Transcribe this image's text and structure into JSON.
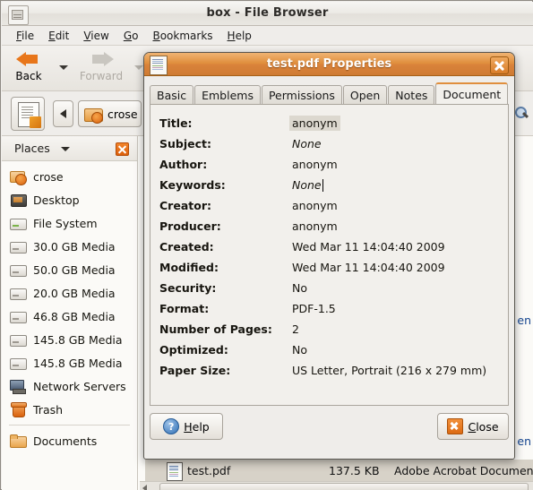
{
  "file_browser": {
    "window_title": "box - File Browser",
    "window_icon": "drive-icon",
    "menus": [
      {
        "label": "File",
        "accel": "F"
      },
      {
        "label": "Edit",
        "accel": "E"
      },
      {
        "label": "View",
        "accel": "V"
      },
      {
        "label": "Go",
        "accel": "G"
      },
      {
        "label": "Bookmarks",
        "accel": "B"
      },
      {
        "label": "Help",
        "accel": "H"
      }
    ],
    "toolbar": {
      "back_label": "Back",
      "forward_label": "Forward",
      "back_icon": "arrow-left-icon",
      "forward_icon": "arrow-right-icon"
    },
    "location_bar": {
      "edit_location_icon": "document-edit-icon",
      "scroll_left_icon": "triangle-left-icon",
      "path_button_label": "crose",
      "path_button_icon": "home-folder-icon"
    },
    "sidebar": {
      "header_label": "Places",
      "header_caret_icon": "chevron-down-icon",
      "close_icon": "close-icon",
      "items": [
        {
          "label": "crose",
          "icon": "home-folder-icon"
        },
        {
          "label": "Desktop",
          "icon": "desktop-icon"
        },
        {
          "label": "File System",
          "icon": "drive-icon"
        },
        {
          "label": "30.0 GB Media",
          "icon": "drive-icon"
        },
        {
          "label": "50.0 GB Media",
          "icon": "drive-icon"
        },
        {
          "label": "20.0 GB Media",
          "icon": "drive-icon"
        },
        {
          "label": "46.8 GB Media",
          "icon": "drive-icon"
        },
        {
          "label": "145.8 GB Media",
          "icon": "drive-icon"
        },
        {
          "label": "145.8 GB Media",
          "icon": "drive-icon"
        },
        {
          "label": "Network Servers",
          "icon": "network-icon"
        },
        {
          "label": "Trash",
          "icon": "trash-icon"
        }
      ],
      "items_after_separator": [
        {
          "label": "Documents",
          "icon": "folder-icon"
        }
      ]
    },
    "main_pane": {
      "search_icon": "magnifier-icon",
      "clipped_text_1": "en",
      "clipped_text_2": "en",
      "clipped_text_3": "en"
    },
    "selected_file_row": {
      "icon": "pdf-document-icon",
      "name": "test.pdf",
      "size": "137.5 KB",
      "type": "Adobe Acrobat Documen"
    },
    "hscrollbar": {
      "left_arrow_icon": "triangle-left-icon"
    }
  },
  "dialog": {
    "title": "test.pdf Properties",
    "title_icon": "pdf-document-icon",
    "close_icon": "close-icon",
    "tabs": [
      {
        "label": "Basic",
        "active": false
      },
      {
        "label": "Emblems",
        "active": false
      },
      {
        "label": "Permissions",
        "active": false
      },
      {
        "label": "Open With",
        "active": false
      },
      {
        "label": "Notes",
        "active": false
      },
      {
        "label": "Document",
        "active": true
      }
    ],
    "document_properties": [
      {
        "key": "Title:",
        "value": "anonym",
        "style": "selected"
      },
      {
        "key": "Subject:",
        "value": "None",
        "style": "italic"
      },
      {
        "key": "Author:",
        "value": "anonym",
        "style": "normal"
      },
      {
        "key": "Keywords:",
        "value": "None",
        "style": "italic-cursor"
      },
      {
        "key": "Creator:",
        "value": "anonym",
        "style": "normal"
      },
      {
        "key": "Producer:",
        "value": "anonym",
        "style": "normal"
      },
      {
        "key": "Created:",
        "value": "Wed Mar 11 14:04:40 2009",
        "style": "normal"
      },
      {
        "key": "Modified:",
        "value": "Wed Mar 11 14:04:40 2009",
        "style": "normal"
      },
      {
        "key": "Security:",
        "value": "No",
        "style": "normal"
      },
      {
        "key": "Format:",
        "value": "PDF-1.5",
        "style": "normal"
      },
      {
        "key": "Number of Pages:",
        "value": "2",
        "style": "normal"
      },
      {
        "key": "Optimized:",
        "value": "No",
        "style": "normal"
      },
      {
        "key": "Paper Size:",
        "value": "US Letter, Portrait (216 x 279 mm)",
        "style": "normal"
      }
    ],
    "buttons": {
      "help_label": "Help",
      "help_accel": "H",
      "help_icon": "help-circle-icon",
      "close_label": "Close",
      "close_accel": "C",
      "close_icon": "close-x-icon"
    }
  },
  "colors": {
    "dialog_titlebar": "#e08f3e",
    "accent_orange": "#e8761a",
    "window_bg": "#efedea",
    "panel_bg": "#f2f0ec",
    "selection_bg": "#dcd8cf",
    "file_row_bg": "#d7d2c8"
  }
}
